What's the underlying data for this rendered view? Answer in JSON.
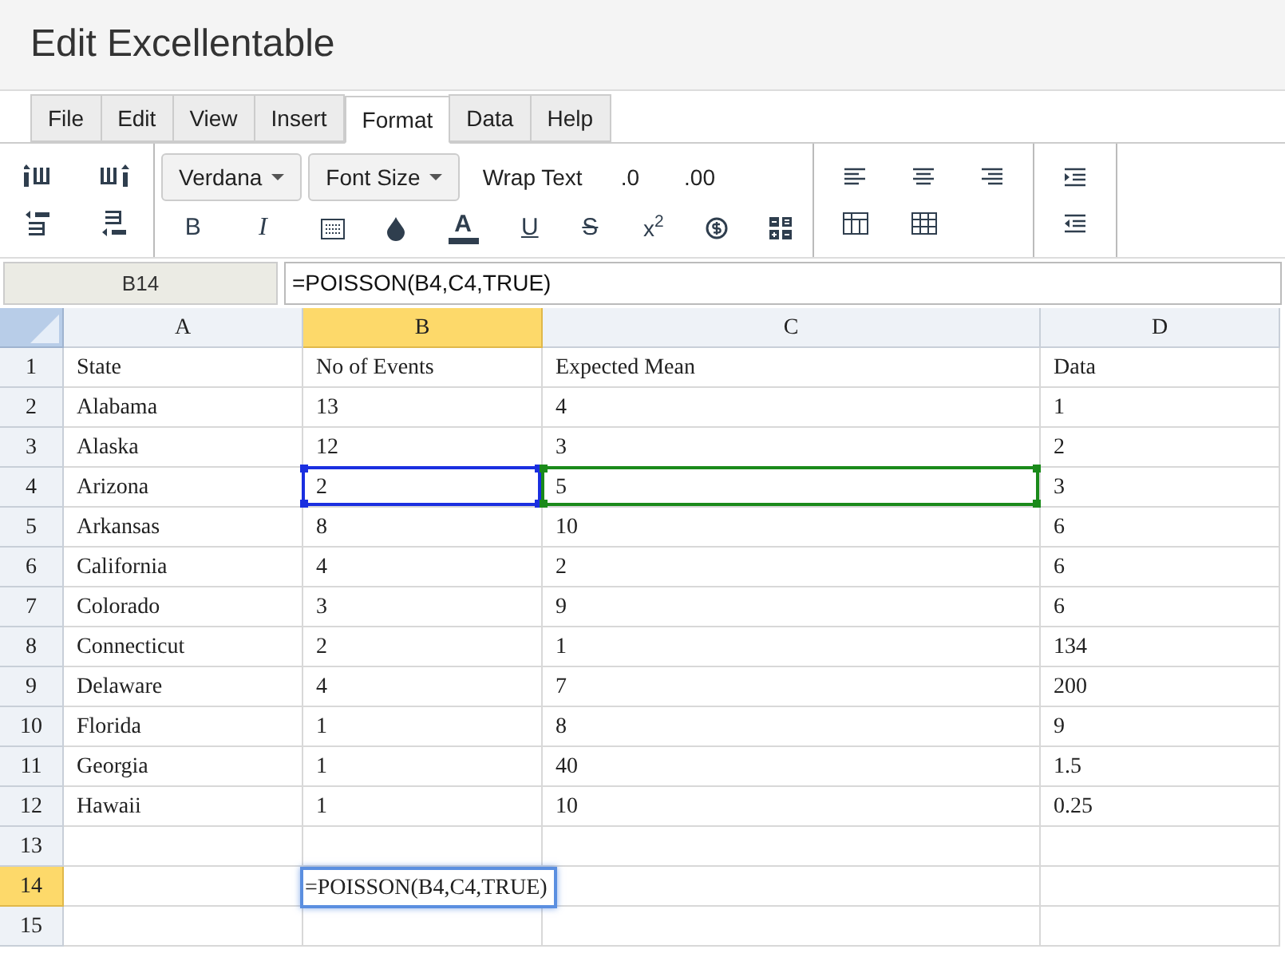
{
  "app": {
    "title": "Edit Excellentable"
  },
  "menu_tabs": [
    {
      "label": "File",
      "selected": false
    },
    {
      "label": "Edit",
      "selected": false
    },
    {
      "label": "View",
      "selected": false
    },
    {
      "label": "Insert",
      "selected": false
    },
    {
      "label": "Format",
      "selected": true
    },
    {
      "label": "Data",
      "selected": false
    },
    {
      "label": "Help",
      "selected": false
    }
  ],
  "toolbar": {
    "font_menu": "Verdana",
    "font_size_menu": "Font Size",
    "wrap_text": "Wrap Text",
    "decimals": [
      ".0",
      ".00"
    ],
    "bold": "B",
    "italic": "I",
    "font_color": "A",
    "underline": "U",
    "strikethrough": "S",
    "superscript": "x$^{2}$"
  },
  "formula_bar": {
    "cell_ref": "B14",
    "formula": "=POISSON(B4,C4,TRUE)"
  },
  "sheet": {
    "columns": [
      {
        "label": "A",
        "selected": false
      },
      {
        "label": "B",
        "selected": true
      },
      {
        "label": "C",
        "selected": false
      },
      {
        "label": "D",
        "selected": false
      }
    ],
    "rows": [
      {
        "label": "1",
        "selected": false,
        "cells": [
          {
            "text": "State"
          },
          {
            "text": "No of Events"
          },
          {
            "text": "Expected Mean"
          },
          {
            "text": "Data"
          }
        ]
      },
      {
        "label": "2",
        "selected": false,
        "cells": [
          {
            "text": "Alabama"
          },
          {
            "text": "13"
          },
          {
            "text": "4"
          },
          {
            "text": "1"
          }
        ]
      },
      {
        "label": "3",
        "selected": false,
        "cells": [
          {
            "text": "Alaska"
          },
          {
            "text": "12"
          },
          {
            "text": "3"
          },
          {
            "text": "2"
          }
        ]
      },
      {
        "label": "4",
        "selected": false,
        "cells": [
          {
            "text": "Arizona"
          },
          {
            "text": "2",
            "color": "#1a2fe0"
          },
          {
            "text": "5",
            "color": "#1a8a1a"
          },
          {
            "text": "3"
          }
        ]
      },
      {
        "label": "5",
        "selected": false,
        "cells": [
          {
            "text": "Arkansas"
          },
          {
            "text": "8"
          },
          {
            "text": "10"
          },
          {
            "text": "6"
          }
        ]
      },
      {
        "label": "6",
        "selected": false,
        "cells": [
          {
            "text": "California"
          },
          {
            "text": "4"
          },
          {
            "text": "2"
          },
          {
            "text": "6"
          }
        ]
      },
      {
        "label": "7",
        "selected": false,
        "cells": [
          {
            "text": "Colorado"
          },
          {
            "text": "3"
          },
          {
            "text": "9"
          },
          {
            "text": "6"
          }
        ]
      },
      {
        "label": "8",
        "selected": false,
        "cells": [
          {
            "text": "Connecticut"
          },
          {
            "text": "2"
          },
          {
            "text": "1"
          },
          {
            "text": "134"
          }
        ]
      },
      {
        "label": "9",
        "selected": false,
        "cells": [
          {
            "text": "Delaware"
          },
          {
            "text": "4"
          },
          {
            "text": "7"
          },
          {
            "text": "200"
          }
        ]
      },
      {
        "label": "10",
        "selected": false,
        "cells": [
          {
            "text": "Florida"
          },
          {
            "text": "1"
          },
          {
            "text": "8"
          },
          {
            "text": "9"
          }
        ]
      },
      {
        "label": "11",
        "selected": false,
        "cells": [
          {
            "text": "Georgia"
          },
          {
            "text": "1"
          },
          {
            "text": "40"
          },
          {
            "text": "1.5"
          }
        ]
      },
      {
        "label": "12",
        "selected": false,
        "cells": [
          {
            "text": "Hawaii"
          },
          {
            "text": "1"
          },
          {
            "text": "10"
          },
          {
            "text": "0.25"
          }
        ]
      },
      {
        "label": "13",
        "selected": false,
        "cells": [
          null,
          null,
          null,
          null
        ]
      },
      {
        "label": "14",
        "selected": true,
        "cells": [
          null,
          {
            "editing": true,
            "value": "=POISSON(B4,C4,TRUE)"
          },
          null,
          null
        ]
      },
      {
        "label": "15",
        "selected": false,
        "cells": [
          null,
          null,
          null,
          null
        ]
      }
    ]
  }
}
